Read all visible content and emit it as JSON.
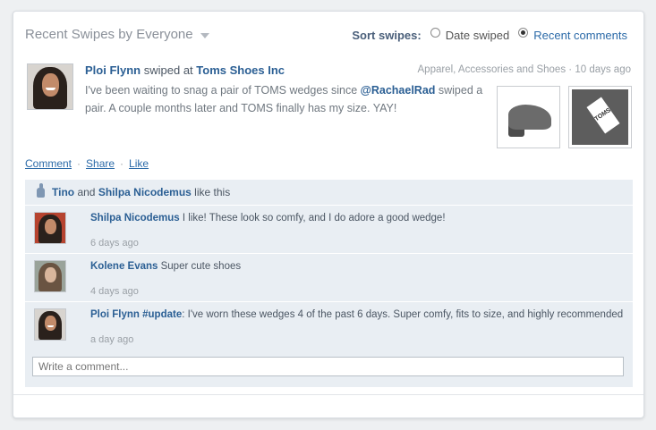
{
  "header": {
    "title": "Recent Swipes by Everyone",
    "sort_label": "Sort swipes:",
    "sort_options": [
      {
        "label": "Date swiped",
        "selected": false
      },
      {
        "label": "Recent comments",
        "selected": true
      }
    ]
  },
  "post": {
    "author": "Ploi Flynn",
    "action": " swiped at ",
    "store": "Toms Shoes Inc",
    "category": "Apparel, Accessories and Shoes",
    "sep": "·",
    "time": "10 days ago",
    "body_part1": "I've been waiting to snag a pair of TOMS wedges since ",
    "mention": "@RachaelRad",
    "body_part2": " swiped a pair. A couple months later and TOMS finally has my size. YAY!",
    "tag_text": "TOMS"
  },
  "actions": {
    "comment": "Comment",
    "share": "Share",
    "like": "Like",
    "dot": "·"
  },
  "likes": {
    "user1": "Tino",
    "and": " and ",
    "user2": "Shilpa Nicodemus",
    "suffix": " like this"
  },
  "comments": [
    {
      "author": "Shilpa Nicodemus",
      "text": " I like! These look so comfy, and I do adore a good wedge!",
      "time": "6 days ago"
    },
    {
      "author": "Kolene Evans",
      "text": " Super cute shoes",
      "time": "4 days ago"
    },
    {
      "author": "Ploi Flynn #update",
      "text": ": I've worn these wedges 4 of the past 6 days. Super comfy, fits to size, and highly recommended",
      "time": "a day ago"
    }
  ],
  "comment_input": {
    "placeholder": "Write a comment..."
  },
  "colors": {
    "link": "#2b5f94",
    "panel": "#e9eef3",
    "muted": "#9aa0a6"
  }
}
